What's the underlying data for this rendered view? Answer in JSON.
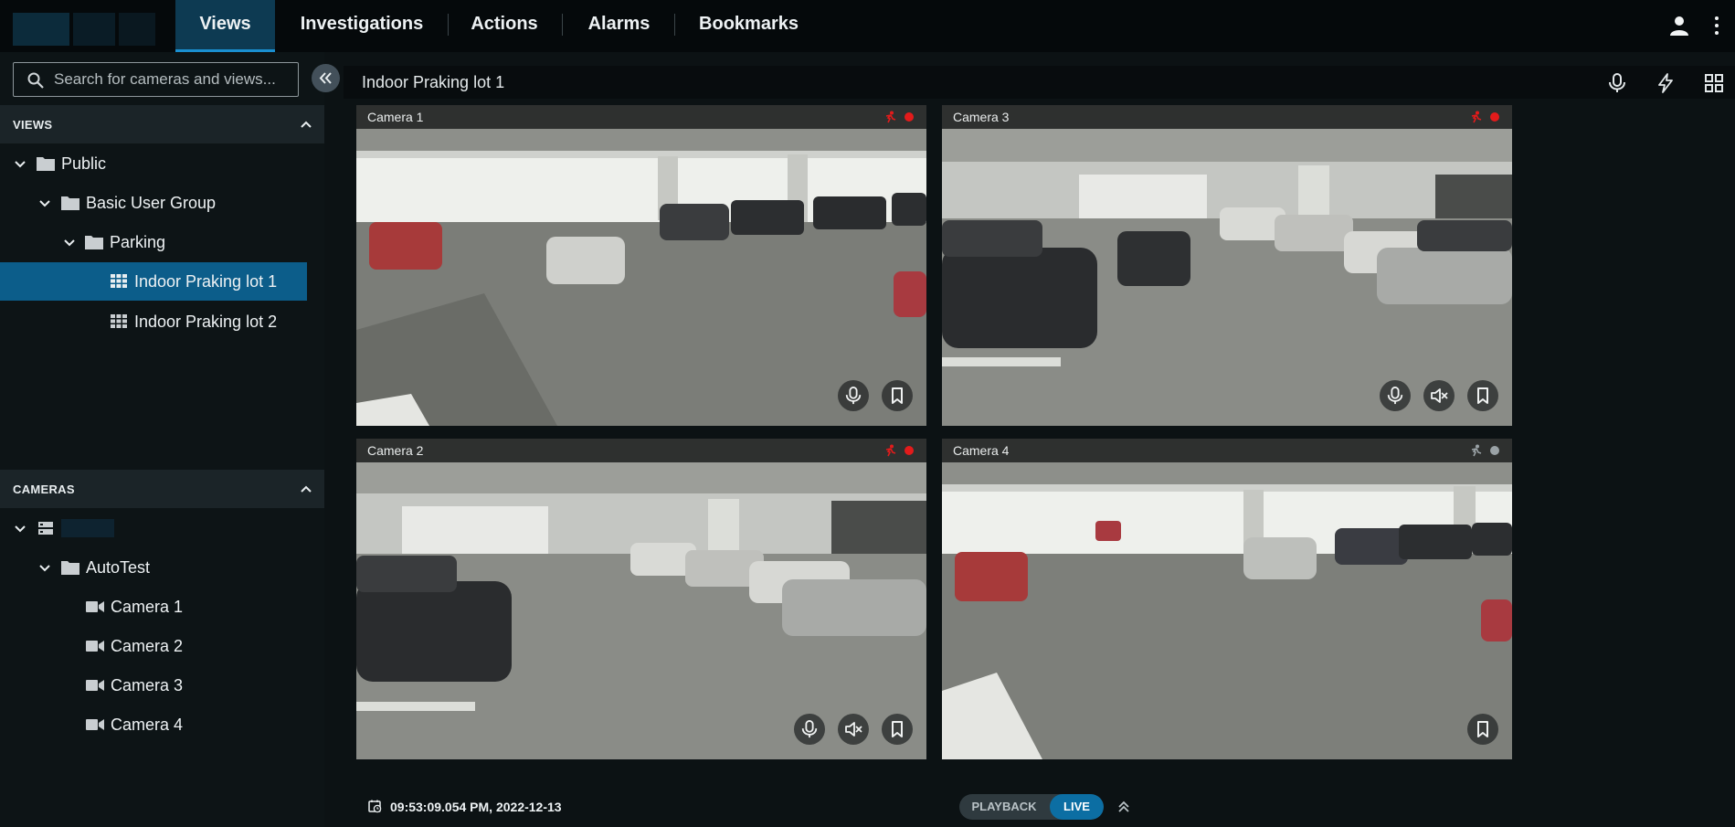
{
  "nav": {
    "tabs": [
      {
        "label": "Views",
        "active": true
      },
      {
        "label": "Investigations",
        "active": false
      },
      {
        "label": "Actions",
        "active": false
      },
      {
        "label": "Alarms",
        "active": false
      },
      {
        "label": "Bookmarks",
        "active": false
      }
    ],
    "icons": [
      "user-icon",
      "kebab-menu-icon"
    ]
  },
  "sidebar": {
    "search": {
      "placeholder": "Search for cameras and views...",
      "value": ""
    },
    "views_section": {
      "label": "VIEWS",
      "items": [
        {
          "label": "Public",
          "type": "folder",
          "expanded": true
        },
        {
          "label": "Basic User Group",
          "type": "folder",
          "expanded": true
        },
        {
          "label": "Parking",
          "type": "folder",
          "expanded": true
        },
        {
          "label": "Indoor Praking lot 1",
          "type": "view",
          "selected": true
        },
        {
          "label": "Indoor Praking lot 2",
          "type": "view",
          "selected": false
        }
      ]
    },
    "cameras_section": {
      "label": "CAMERAS",
      "items": [
        {
          "label": "",
          "type": "server",
          "expanded": true
        },
        {
          "label": "AutoTest",
          "type": "folder",
          "expanded": true
        },
        {
          "label": "Camera 1",
          "type": "camera"
        },
        {
          "label": "Camera 2",
          "type": "camera"
        },
        {
          "label": "Camera 3",
          "type": "camera"
        },
        {
          "label": "Camera 4",
          "type": "camera"
        }
      ]
    }
  },
  "main": {
    "view_title": "Indoor Praking lot 1",
    "header_icons": [
      "microphone-icon",
      "lightning-icon",
      "grid-layout-icon"
    ],
    "tiles": [
      {
        "name": "Camera 1",
        "recording": true,
        "motion": true,
        "controls": [
          "microphone",
          "bookmark"
        ]
      },
      {
        "name": "Camera 3",
        "recording": true,
        "motion": true,
        "controls": [
          "microphone",
          "mute",
          "bookmark"
        ]
      },
      {
        "name": "Camera 2",
        "recording": true,
        "motion": true,
        "controls": [
          "microphone",
          "mute",
          "bookmark"
        ]
      },
      {
        "name": "Camera 4",
        "recording": false,
        "motion": false,
        "controls": [
          "bookmark"
        ]
      }
    ]
  },
  "bottom": {
    "timestamp": "09:53:09.054 PM, 2022-12-13",
    "mode_playback": "PLAYBACK",
    "mode_live": "LIVE",
    "active_mode": "LIVE"
  },
  "colors": {
    "accent": "#1a8fd0",
    "selected_bg": "#0c5d8a",
    "recording": "#e31b1b",
    "idle_dot": "#9aa2a6",
    "live_bg": "#0c6ea3"
  }
}
